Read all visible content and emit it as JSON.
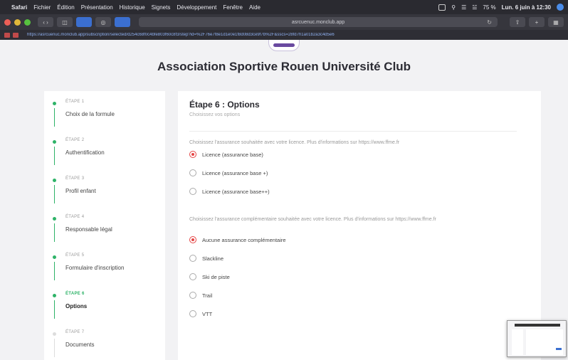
{
  "menubar": {
    "items": [
      "Safari",
      "Fichier",
      "Édition",
      "Présentation",
      "Historique",
      "Signets",
      "Développement",
      "Fenêtre",
      "Aide"
    ],
    "battery": "75 %",
    "clock": "Lun. 6 juin à 12:30"
  },
  "browser": {
    "url_short": "asrcuenuc.monclub.app",
    "url_full": "https://asrcuenuc.monclub.app/subscription/selected/d254c68f0c4bfe803f60c8f3/step?id=%2F76e7f8e1d1e0e1f8d08d3ce9f7b%2F&sscs=28fd7h1a01b2a3c4d5e6"
  },
  "page": {
    "club_title": "Association Sportive Rouen Université Club"
  },
  "steps": [
    {
      "num": "ÉTAPE 1",
      "label": "Choix de la formule"
    },
    {
      "num": "ÉTAPE 2",
      "label": "Authentification"
    },
    {
      "num": "ÉTAPE 3",
      "label": "Profil enfant"
    },
    {
      "num": "ÉTAPE 4",
      "label": "Responsable légal"
    },
    {
      "num": "ÉTAPE 5",
      "label": "Formulaire d'inscription"
    },
    {
      "num": "ÉTAPE 6",
      "label": "Options"
    },
    {
      "num": "ÉTAPE 7",
      "label": "Documents"
    }
  ],
  "form": {
    "title": "Étape 6 : Options",
    "subtitle": "Choisissez vos options",
    "group1": {
      "prompt": "Choisissez l'assurance souhaitée avec votre licence. Plus d'informations sur https://www.ffme.fr",
      "options": [
        "Licence (assurance base)",
        "Licence (assurance base +)",
        "Licence (assurance base++)"
      ],
      "selected": 0
    },
    "group2": {
      "prompt": "Choisissez l'assurance complémentaire souhaitée avec votre licence. Plus d'informations sur https://www.ffme.fr",
      "options": [
        "Aucune assurance complémentaire",
        "Slackline",
        "Ski de piste",
        "Trail",
        "VTT"
      ],
      "selected": 0
    }
  },
  "colors": {
    "accent_green": "#2eb368",
    "radio_selected": "#e54545"
  }
}
